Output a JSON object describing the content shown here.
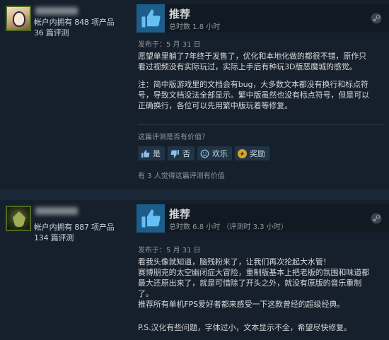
{
  "reviews": [
    {
      "author": {
        "products_line": "帐户内拥有 848 项产品",
        "reviews_line": "36 篇评测"
      },
      "vote": {
        "title": "推荐",
        "hours": "总时数 1.8 小时"
      },
      "posted": "发布于：5 月 31 日",
      "paragraphs": [
        [
          "愿望单里躺了7年终于发售了，优化和本地化做的都很不错，原作只",
          "看过视频没有实际玩过，实际上手后有种玩3D版恶魔城的感觉。"
        ],
        [
          "注：简中版游戏里的文档会有bug，大多数文本都没有换行和标点符",
          "号，导致文档没法全部显示。繁中版虽然也没有标点符号，但是可以",
          "正确换行，各位可以先用繁中版玩着等修复。"
        ]
      ],
      "helpful_question": "这篇评测是否有价值？",
      "buttons": {
        "yes": "是",
        "no": "否",
        "funny": "欢乐",
        "award": "奖励"
      },
      "helpful_count": "有 3 人觉得这篇评测有价值"
    },
    {
      "author": {
        "products_line": "帐户内拥有 887 项产品",
        "reviews_line": "134 篇评测"
      },
      "vote": {
        "title": "推荐",
        "hours": "总时数 6.8 小时 （评测时 3.3 小时）"
      },
      "posted": "发布于：5 月 31 日",
      "lines": [
        "看我头像就知道，脑残粉来了，让我们再次抡起大水管！",
        "赛博朋克的太空幽闭症大冒险，重制版基本上把老版的氛围和味道都",
        "最大还原出来了，就是可惜除了开头之外，就没有原版的音乐重制",
        "了。",
        "推荐所有单机FPS爱好者都来感受一下这款曾经的超级经典。"
      ],
      "last_line": "P.S.汉化有些问题，字体过小，文本显示不全，希望尽快修复。"
    }
  ],
  "colors": {
    "background": "#1b2838",
    "review_bg": "#16202d",
    "thumb_bg": "#1d5d8a",
    "thumb_icon": "#66c0f4"
  }
}
